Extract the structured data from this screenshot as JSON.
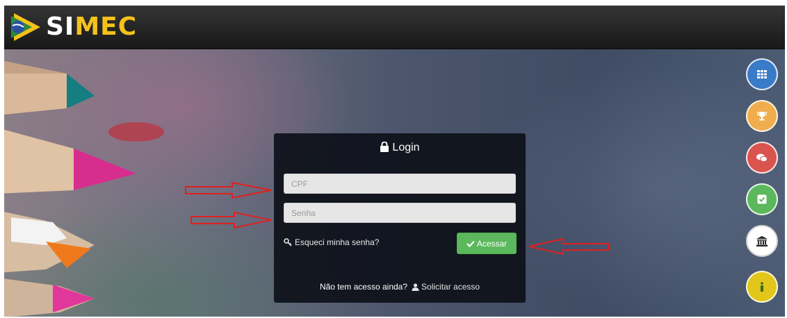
{
  "header": {
    "logo_text_a": "SI",
    "logo_text_b": "MEC"
  },
  "login": {
    "title": "Login",
    "cpf_placeholder": "CPF",
    "senha_placeholder": "Senha",
    "forgot_label": "Esqueci minha senha?",
    "submit_label": "Acessar",
    "no_access_label": "Não tem acesso ainda?",
    "request_label": "Solicitar acesso"
  },
  "side_buttons": [
    {
      "icon": "grid-icon",
      "color": "#3a7bc8"
    },
    {
      "icon": "trophy-icon",
      "color": "#f0ad4e"
    },
    {
      "icon": "chat-icon",
      "color": "#d9534f"
    },
    {
      "icon": "checkbox-icon",
      "color": "#5cb85c"
    },
    {
      "icon": "institution-icon",
      "color": "#ffffff"
    },
    {
      "icon": "info-icon",
      "color": "#e2c619"
    }
  ],
  "colors": {
    "accent_yellow": "#f4c21a",
    "submit_green": "#5cb85c",
    "annotation_red": "#e02020"
  }
}
